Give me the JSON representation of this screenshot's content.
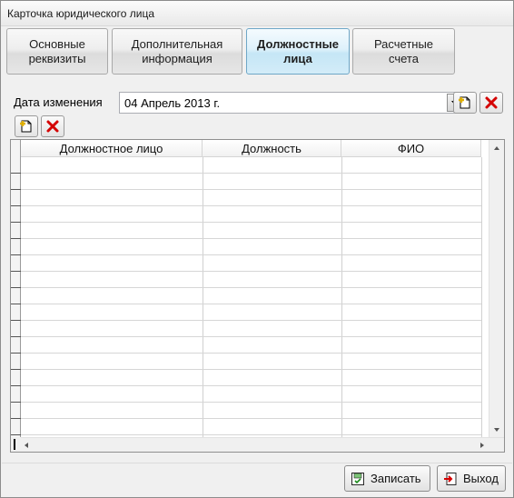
{
  "window": {
    "title": "Карточка юридического лица"
  },
  "tabs": [
    {
      "label": "Основные\nреквизиты",
      "active": false
    },
    {
      "label": "Дополнительная\nинформация",
      "active": false
    },
    {
      "label": "Должностные\nлица",
      "active": true
    },
    {
      "label": "Расчетные\nсчета",
      "active": false
    }
  ],
  "date_filter": {
    "label": "Дата изменения",
    "value": "04 Апрель 2013 г."
  },
  "grid": {
    "columns": [
      "Должностное лицо",
      "Должность",
      "ФИО"
    ],
    "rows": []
  },
  "footer": {
    "save_label": "Записать",
    "exit_label": "Выход"
  },
  "icons": {
    "add": "add-document-icon",
    "delete": "delete-x-icon",
    "save": "save-icon",
    "exit": "exit-icon"
  },
  "colors": {
    "active_tab": "#c5e6f6",
    "delete_red": "#d40000",
    "add_yellow": "#f2d021"
  }
}
